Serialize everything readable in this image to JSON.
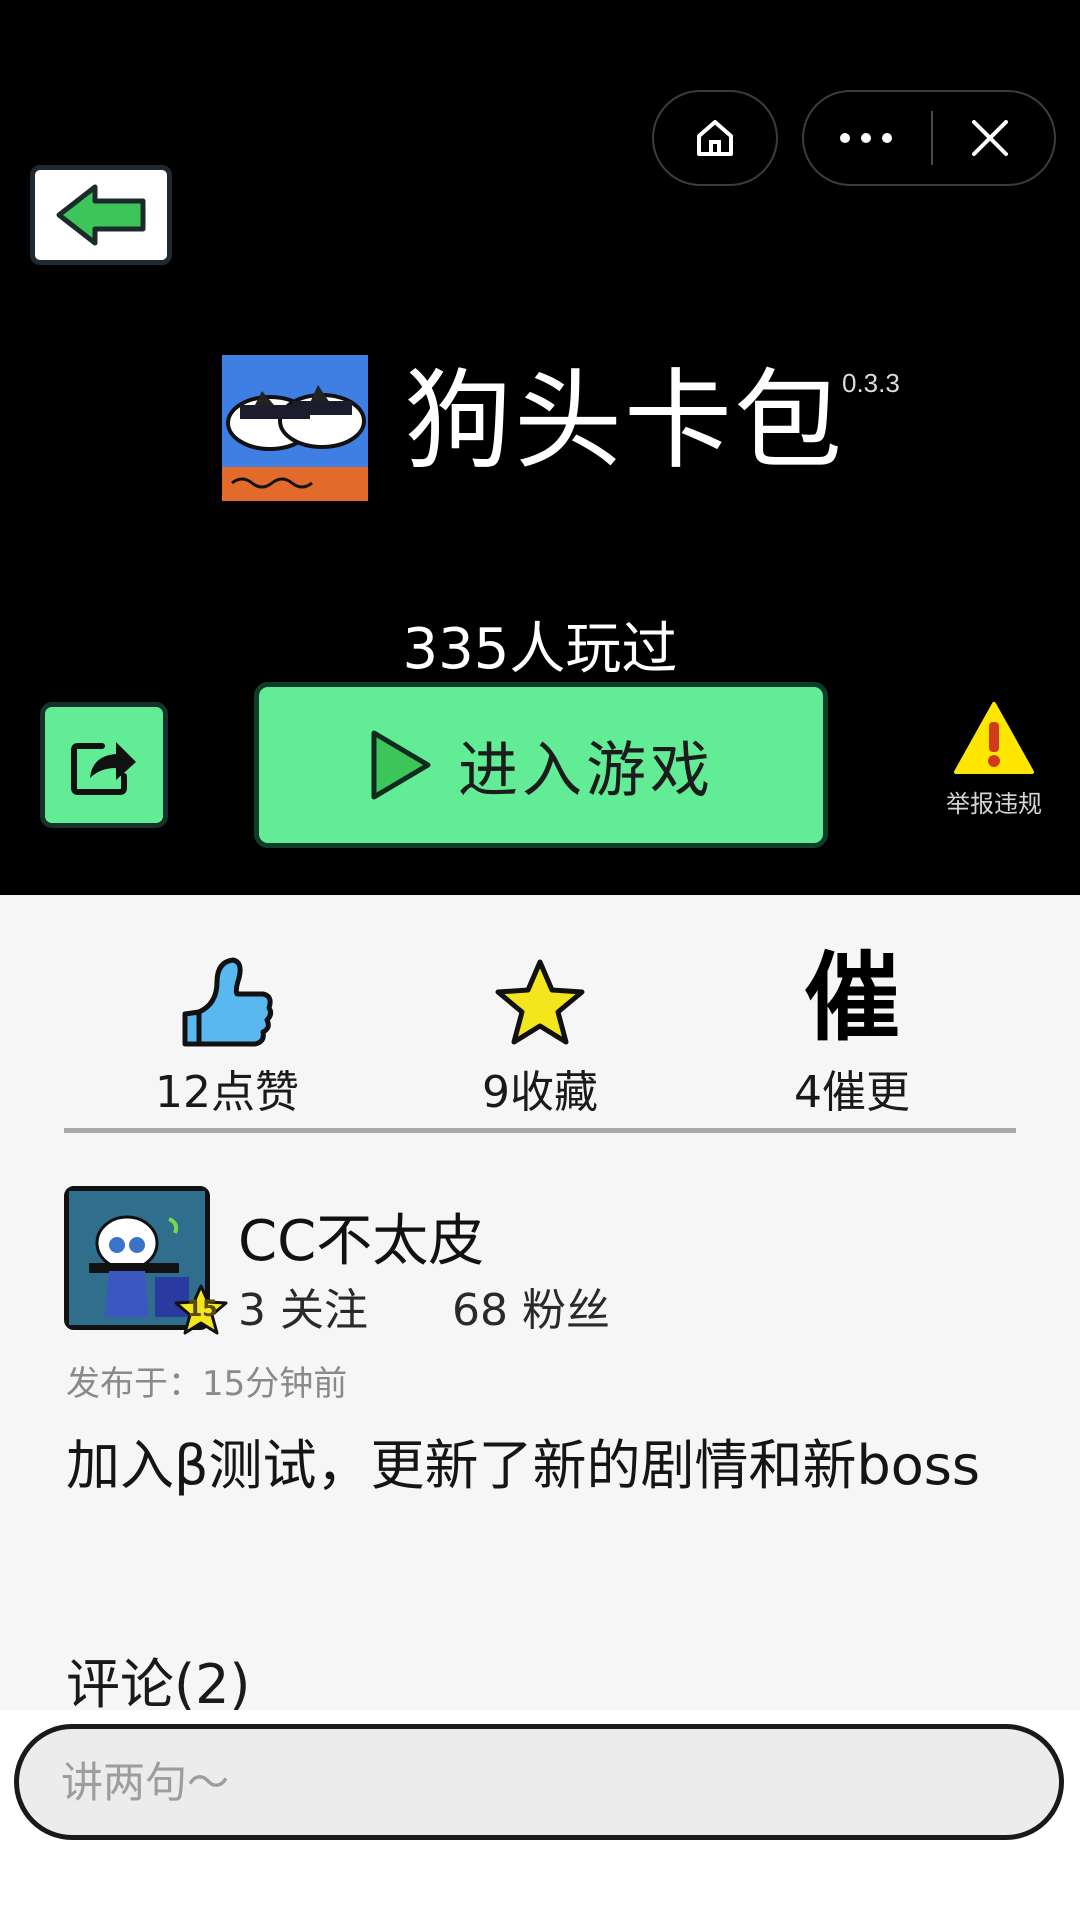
{
  "window": {
    "home_icon": "home-icon",
    "more_icon": "more-dots-icon",
    "close_icon": "close-icon"
  },
  "game": {
    "title": "狗头卡包",
    "version": "0.3.3",
    "play_count": "335人玩过",
    "enter_label": "进入游戏",
    "report_label": "举报违规"
  },
  "stats": {
    "likes": "12点赞",
    "favorites": "9收藏",
    "urge": "4催更",
    "urge_glyph": "催"
  },
  "author": {
    "name": "CC不太皮",
    "level": "15",
    "following": "3 关注",
    "followers": "68 粉丝"
  },
  "post": {
    "published": "发布于：15分钟前",
    "description": "加入β测试，更新了新的剧情和新boss"
  },
  "comments": {
    "title": "评论(2)",
    "placeholder": "讲两句～"
  },
  "colors": {
    "accent_green": "#63ec96",
    "header_bg": "#000000",
    "body_bg": "#f6f6f6",
    "warning_yellow": "#ffe600",
    "like_blue": "#5ab8f0",
    "star_yellow": "#f3e61c"
  }
}
